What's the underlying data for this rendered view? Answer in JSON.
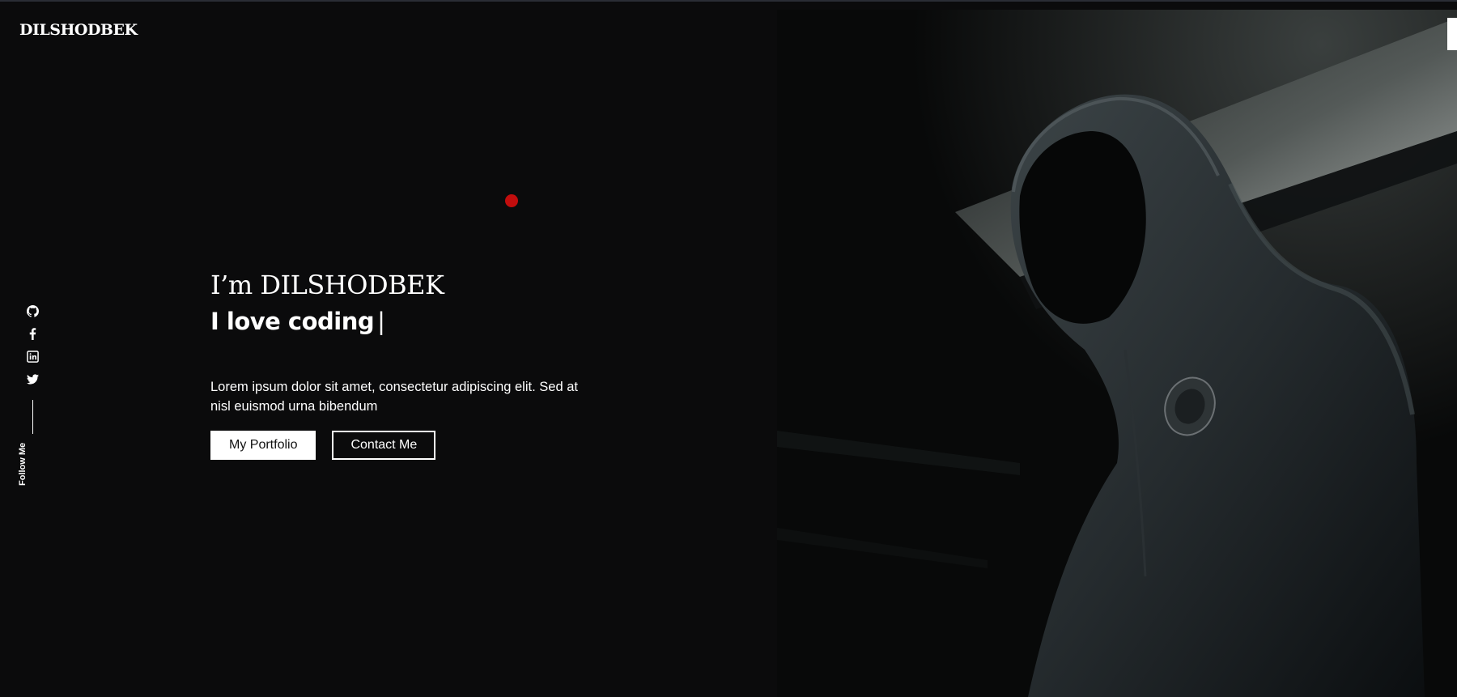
{
  "brand": "DILSHODBEK",
  "hero": {
    "greeting": "I’m DILSHODBEK",
    "typed_text": "I love coding",
    "cursor": "|",
    "description": "Lorem ipsum dolor sit amet, consectetur adipiscing elit. Sed at nisl euismod urna bibendum",
    "primary_button": "My Portfolio",
    "secondary_button": "Contact Me"
  },
  "social": {
    "icons": [
      "github-icon",
      "facebook-icon",
      "linkedin-icon",
      "twitter-icon"
    ],
    "follow_label": "Follow Me"
  },
  "colors": {
    "background": "#0b0b0c",
    "accent_dot": "#c20d0d",
    "text": "#ffffff"
  }
}
